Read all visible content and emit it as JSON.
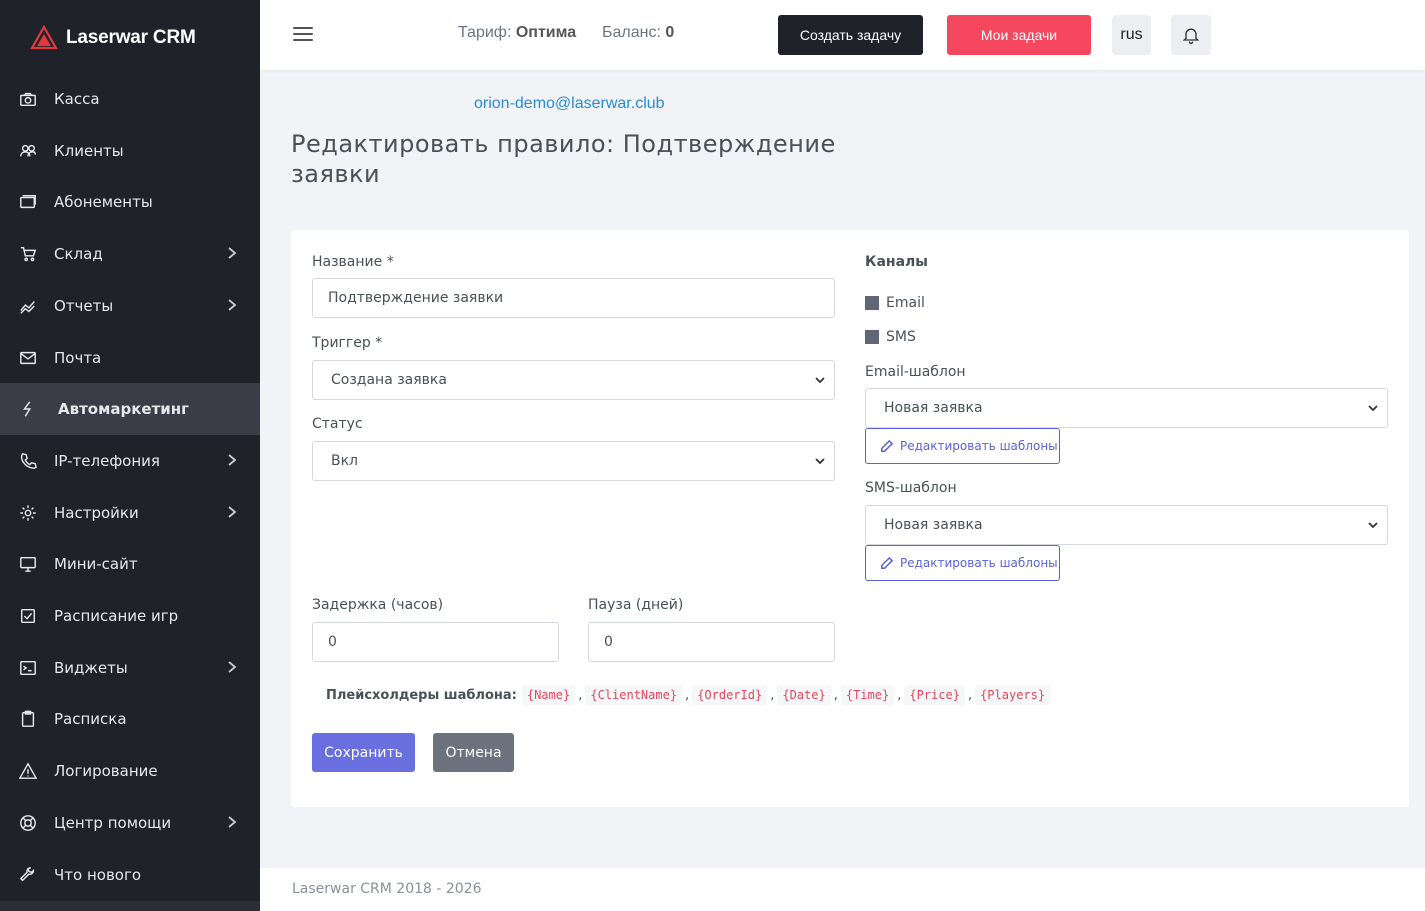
{
  "brand": {
    "name": "Laserwar CRM"
  },
  "sidebar": {
    "items": [
      {
        "label": "Касса",
        "icon": "camera-icon",
        "has_submenu": false
      },
      {
        "label": "Клиенты",
        "icon": "users-icon",
        "has_submenu": false
      },
      {
        "label": "Абонементы",
        "icon": "cards-icon",
        "has_submenu": false
      },
      {
        "label": "Склад",
        "icon": "cart-icon",
        "has_submenu": true
      },
      {
        "label": "Отчеты",
        "icon": "chart-icon",
        "has_submenu": true
      },
      {
        "label": "Почта",
        "icon": "mail-icon",
        "has_submenu": false
      },
      {
        "label": "Автомаркетинг",
        "icon": "lightning-icon",
        "has_submenu": false,
        "active": true
      },
      {
        "label": "IP-телефония",
        "icon": "phone-icon",
        "has_submenu": true
      },
      {
        "label": "Настройки",
        "icon": "gear-icon",
        "has_submenu": true
      },
      {
        "label": "Мини-сайт",
        "icon": "monitor-icon",
        "has_submenu": false
      },
      {
        "label": "Расписание игр",
        "icon": "calendar-check-icon",
        "has_submenu": false
      },
      {
        "label": "Виджеты",
        "icon": "terminal-icon",
        "has_submenu": true
      },
      {
        "label": "Расписка",
        "icon": "clipboard-icon",
        "has_submenu": false
      },
      {
        "label": "Логирование",
        "icon": "warning-icon",
        "has_submenu": false
      },
      {
        "label": "Центр помощи",
        "icon": "lifebuoy-icon",
        "has_submenu": true
      },
      {
        "label": "Что нового",
        "icon": "wrench-icon",
        "has_submenu": false
      }
    ]
  },
  "header": {
    "tariff_label": "Тариф:",
    "tariff_value": "Оптима",
    "balance_label": "Баланс:",
    "balance_value": "0",
    "create_task": "Создать задачу",
    "my_tasks": "Мои задачи",
    "lang": "rus"
  },
  "user_email": "orion-demo@laserwar.club",
  "page_title": "Редактировать правило: Подтверждение заявки",
  "form": {
    "name_label": "Название *",
    "name_value": "Подтверждение заявки",
    "trigger_label": "Триггер *",
    "trigger_value": "Создана заявка",
    "status_label": "Статус",
    "status_value": "Вкл",
    "delay_label": "Задержка (часов)",
    "delay_value": "0",
    "pause_label": "Пауза (дней)",
    "pause_value": "0",
    "channels_title": "Каналы",
    "channel_email": "Email",
    "channel_sms": "SMS",
    "email_tpl_label": "Email-шаблон",
    "email_tpl_value": "Новая заявка",
    "sms_tpl_label": "SMS-шаблон",
    "sms_tpl_value": "Новая заявка",
    "edit_templates": "Редактировать шаблоны",
    "placeholders_label": "Плейсхолдеры шаблона:",
    "placeholders": [
      "{Name}",
      "{ClientName}",
      "{OrderId}",
      "{Date}",
      "{Time}",
      "{Price}",
      "{Players}"
    ],
    "save": "Сохранить",
    "cancel": "Отмена"
  },
  "footer": {
    "text": "Laserwar CRM 2018 - 2026"
  },
  "colors": {
    "sidebar_bg": "#1f2229",
    "primary": "#6a6fe0",
    "danger": "#f5475e",
    "link": "#2a8bd2"
  }
}
